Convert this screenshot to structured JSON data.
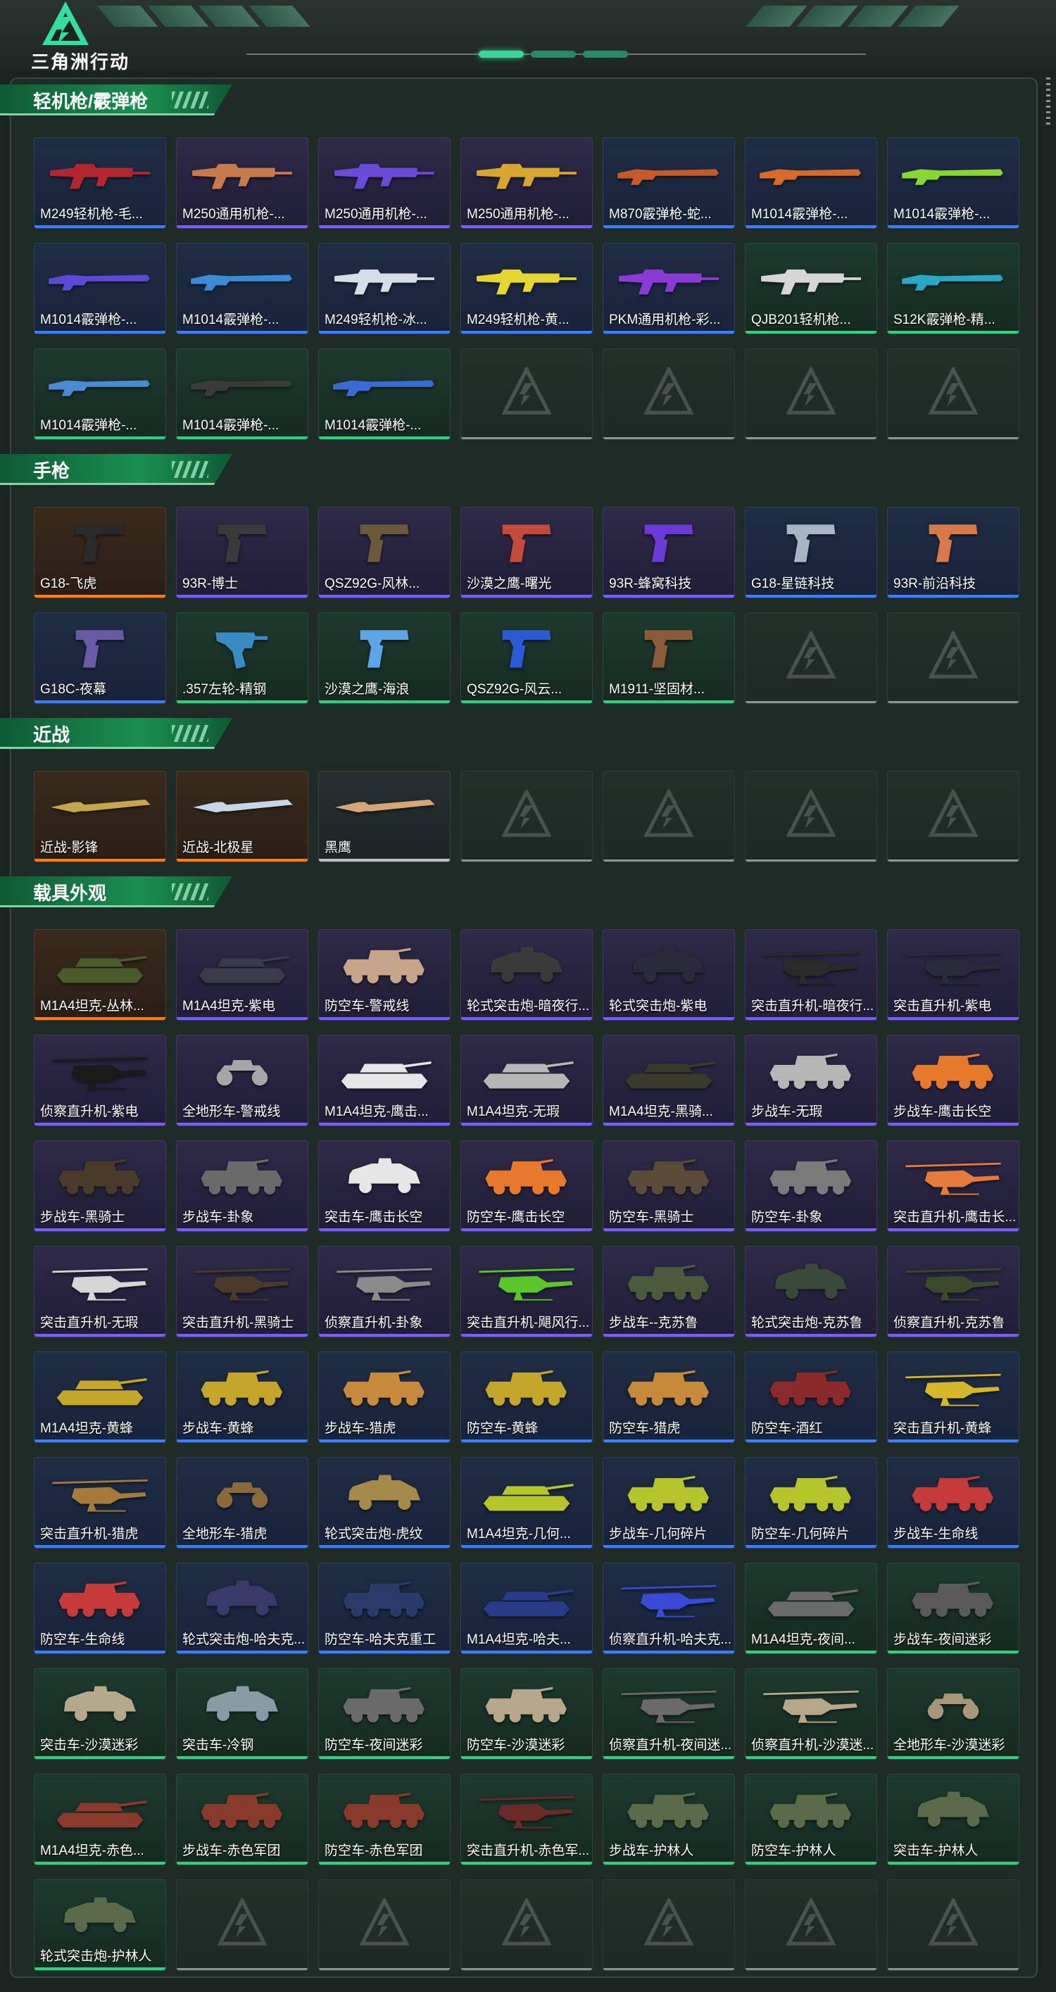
{
  "app": {
    "logo_text": "三角洲行动"
  },
  "sections": [
    {
      "title": "轻机枪/霰弹枪",
      "items": [
        {
          "label": "M249轻机枪-毛...",
          "rarity": "blue",
          "icon": "rifle-icon",
          "color": "#b3262f"
        },
        {
          "label": "M250通用机枪-...",
          "rarity": "purple",
          "icon": "rifle-icon",
          "color": "#c97a4a"
        },
        {
          "label": "M250通用机枪-...",
          "rarity": "purple",
          "icon": "rifle-icon",
          "color": "#6a4ad6"
        },
        {
          "label": "M250通用机枪-...",
          "rarity": "purple",
          "icon": "rifle-icon",
          "color": "#d8a630"
        },
        {
          "label": "M870霰弹枪-蛇...",
          "rarity": "blue",
          "icon": "shotgun-icon",
          "color": "#c75a2a"
        },
        {
          "label": "M1014霰弹枪-...",
          "rarity": "blue",
          "icon": "shotgun-icon",
          "color": "#d86a2a"
        },
        {
          "label": "M1014霰弹枪-...",
          "rarity": "blue",
          "icon": "shotgun-icon",
          "color": "#8ad630"
        },
        {
          "label": "M1014霰弹枪-...",
          "rarity": "blue",
          "icon": "shotgun-icon",
          "color": "#5a4ad6"
        },
        {
          "label": "M1014霰弹枪-...",
          "rarity": "blue",
          "icon": "shotgun-icon",
          "color": "#3a8ad6"
        },
        {
          "label": "M249轻机枪-冰...",
          "rarity": "blue",
          "icon": "rifle-icon",
          "color": "#d6dde6"
        },
        {
          "label": "M249轻机枪-黄...",
          "rarity": "blue",
          "icon": "rifle-icon",
          "color": "#e6d630"
        },
        {
          "label": "PKM通用机枪-彩...",
          "rarity": "blue",
          "icon": "rifle-icon",
          "color": "#8a3ad6"
        },
        {
          "label": "QJB201轻机枪...",
          "rarity": "green",
          "icon": "rifle-icon",
          "color": "#d6d6d6"
        },
        {
          "label": "S12K霰弹枪-精...",
          "rarity": "green",
          "icon": "shotgun-icon",
          "color": "#2aa6c6"
        },
        {
          "label": "M1014霰弹枪-...",
          "rarity": "green",
          "icon": "shotgun-icon",
          "color": "#4a8ad6"
        },
        {
          "label": "M1014霰弹枪-...",
          "rarity": "green",
          "icon": "shotgun-icon",
          "color": "#3a3a3a"
        },
        {
          "label": "M1014霰弹枪-...",
          "rarity": "green",
          "icon": "shotgun-icon",
          "color": "#3a6ad6"
        },
        {
          "label": "",
          "rarity": "empty"
        },
        {
          "label": "",
          "rarity": "empty"
        },
        {
          "label": "",
          "rarity": "empty"
        },
        {
          "label": "",
          "rarity": "empty"
        }
      ]
    },
    {
      "title": "手枪",
      "items": [
        {
          "label": "G18-飞虎",
          "rarity": "orange",
          "icon": "pistol-icon",
          "color": "#2a2a2a"
        },
        {
          "label": "93R-博士",
          "rarity": "purple",
          "icon": "pistol-icon",
          "color": "#3a3a3a"
        },
        {
          "label": "QSZ92G-风林...",
          "rarity": "purple",
          "icon": "pistol-icon",
          "color": "#6a5a3a"
        },
        {
          "label": "沙漠之鹰-曙光",
          "rarity": "purple",
          "icon": "pistol-icon",
          "color": "#c64a3a"
        },
        {
          "label": "93R-蜂窝科技",
          "rarity": "purple",
          "icon": "pistol-icon",
          "color": "#6a3ad6"
        },
        {
          "label": "G18-星链科技",
          "rarity": "blue",
          "icon": "pistol-icon",
          "color": "#a6b6c6"
        },
        {
          "label": "93R-前沿科技",
          "rarity": "blue",
          "icon": "pistol-icon",
          "color": "#d67a4a"
        },
        {
          "label": "G18C-夜幕",
          "rarity": "blue",
          "icon": "pistol-icon",
          "color": "#6a5aa6"
        },
        {
          "label": ".357左轮-精钢",
          "rarity": "green",
          "icon": "revolver-icon",
          "color": "#3a8ac6"
        },
        {
          "label": "沙漠之鹰-海浪",
          "rarity": "green",
          "icon": "pistol-icon",
          "color": "#5aa6e6"
        },
        {
          "label": "QSZ92G-风云...",
          "rarity": "green",
          "icon": "pistol-icon",
          "color": "#2a5ad6"
        },
        {
          "label": "M1911-坚固材...",
          "rarity": "green",
          "icon": "pistol-icon",
          "color": "#8a5a3a"
        },
        {
          "label": "",
          "rarity": "empty"
        },
        {
          "label": "",
          "rarity": "empty"
        }
      ]
    },
    {
      "title": "近战",
      "items": [
        {
          "label": "近战-影锋",
          "rarity": "orange",
          "icon": "knife-icon",
          "color": "#c6a64a"
        },
        {
          "label": "近战-北极星",
          "rarity": "orange",
          "icon": "knife-icon",
          "color": "#c6d6e6"
        },
        {
          "label": "黑鹰",
          "rarity": "gray",
          "icon": "knife-icon",
          "color": "#d6a67a"
        },
        {
          "label": "",
          "rarity": "empty"
        },
        {
          "label": "",
          "rarity": "empty"
        },
        {
          "label": "",
          "rarity": "empty"
        },
        {
          "label": "",
          "rarity": "empty"
        }
      ]
    },
    {
      "title": "载具外观",
      "items": [
        {
          "label": "M1A4坦克-丛林...",
          "rarity": "orange",
          "icon": "tank-icon",
          "color": "#4a5a2a"
        },
        {
          "label": "M1A4坦克-紫电",
          "rarity": "purple",
          "icon": "tank-icon",
          "color": "#3a3a4a"
        },
        {
          "label": "防空车-警戒线",
          "rarity": "purple",
          "icon": "apc-icon",
          "color": "#c6a68a"
        },
        {
          "label": "轮式突击炮-暗夜行...",
          "rarity": "purple",
          "icon": "armored-car-icon",
          "color": "#3a3a3a"
        },
        {
          "label": "轮式突击炮-紫电",
          "rarity": "purple",
          "icon": "armored-car-icon",
          "color": "#2a2a3a"
        },
        {
          "label": "突击直升机-暗夜行...",
          "rarity": "purple",
          "icon": "helicopter-icon",
          "color": "#2a2a2a"
        },
        {
          "label": "突击直升机-紫电",
          "rarity": "purple",
          "icon": "helicopter-icon",
          "color": "#2a2a3a"
        },
        {
          "label": "侦察直升机-紫电",
          "rarity": "purple",
          "icon": "helicopter-icon",
          "color": "#1a1a1a"
        },
        {
          "label": "全地形车-警戒线",
          "rarity": "purple",
          "icon": "atv-icon",
          "color": "#a6a6a6"
        },
        {
          "label": "M1A4坦克-鹰击...",
          "rarity": "purple",
          "icon": "tank-icon",
          "color": "#e6e6e6"
        },
        {
          "label": "M1A4坦克-无瑕",
          "rarity": "purple",
          "icon": "tank-icon",
          "color": "#b6b6b6"
        },
        {
          "label": "M1A4坦克-黑骑...",
          "rarity": "purple",
          "icon": "tank-icon",
          "color": "#3a3a2a"
        },
        {
          "label": "步战车-无瑕",
          "rarity": "purple",
          "icon": "apc-icon",
          "color": "#b6b6b6"
        },
        {
          "label": "步战车-鹰击长空",
          "rarity": "purple",
          "icon": "apc-icon",
          "color": "#e67a2a"
        },
        {
          "label": "步战车-黑骑士",
          "rarity": "purple",
          "icon": "apc-icon",
          "color": "#4a3a2a"
        },
        {
          "label": "步战车-卦象",
          "rarity": "purple",
          "icon": "apc-icon",
          "color": "#6a6a6a"
        },
        {
          "label": "突击车-鹰击长空",
          "rarity": "purple",
          "icon": "armored-car-icon",
          "color": "#e6e6e6"
        },
        {
          "label": "防空车-鹰击长空",
          "rarity": "purple",
          "icon": "apc-icon",
          "color": "#e67a2a"
        },
        {
          "label": "防空车-黑骑士",
          "rarity": "purple",
          "icon": "apc-icon",
          "color": "#5a4a3a"
        },
        {
          "label": "防空车-卦象",
          "rarity": "purple",
          "icon": "apc-icon",
          "color": "#7a7a7a"
        },
        {
          "label": "突击直升机-鹰击长...",
          "rarity": "purple",
          "icon": "helicopter-icon",
          "color": "#e67a3a"
        },
        {
          "label": "突击直升机-无瑕",
          "rarity": "purple",
          "icon": "helicopter-icon",
          "color": "#d6d6d6"
        },
        {
          "label": "突击直升机-黑骑士",
          "rarity": "purple",
          "icon": "helicopter-icon",
          "color": "#4a3a2a"
        },
        {
          "label": "侦察直升机-卦象",
          "rarity": "purple",
          "icon": "helicopter-icon",
          "color": "#8a8a8a"
        },
        {
          "label": "突击直升机-飓风行...",
          "rarity": "purple",
          "icon": "helicopter-icon",
          "color": "#5ac62a"
        },
        {
          "label": "步战车--克苏鲁",
          "rarity": "purple",
          "icon": "apc-icon",
          "color": "#4a5a3a"
        },
        {
          "label": "轮式突击炮-克苏鲁",
          "rarity": "purple",
          "icon": "armored-car-icon",
          "color": "#3a4a3a"
        },
        {
          "label": "侦察直升机-克苏鲁",
          "rarity": "purple",
          "icon": "helicopter-icon",
          "color": "#3a4a2a"
        },
        {
          "label": "M1A4坦克-黄蜂",
          "rarity": "blue",
          "icon": "tank-icon",
          "color": "#c6a62a"
        },
        {
          "label": "步战车-黄蜂",
          "rarity": "blue",
          "icon": "apc-icon",
          "color": "#c6a62a"
        },
        {
          "label": "步战车-猎虎",
          "rarity": "blue",
          "icon": "apc-icon",
          "color": "#c68a3a"
        },
        {
          "label": "防空车-黄蜂",
          "rarity": "blue",
          "icon": "apc-icon",
          "color": "#c6a62a"
        },
        {
          "label": "防空车-猎虎",
          "rarity": "blue",
          "icon": "apc-icon",
          "color": "#c68a3a"
        },
        {
          "label": "防空车-酒红",
          "rarity": "blue",
          "icon": "apc-icon",
          "color": "#8a2a2a"
        },
        {
          "label": "突击直升机-黄蜂",
          "rarity": "blue",
          "icon": "helicopter-icon",
          "color": "#d6b62a"
        },
        {
          "label": "突击直升机-猎虎",
          "rarity": "blue",
          "icon": "helicopter-icon",
          "color": "#a67a3a"
        },
        {
          "label": "全地形车-猎虎",
          "rarity": "blue",
          "icon": "atv-icon",
          "color": "#8a6a3a"
        },
        {
          "label": "轮式突击炮-虎纹",
          "rarity": "blue",
          "icon": "armored-car-icon",
          "color": "#a68a4a"
        },
        {
          "label": "M1A4坦克-几何...",
          "rarity": "blue",
          "icon": "tank-icon",
          "color": "#b6c62a"
        },
        {
          "label": "步战车-几何碎片",
          "rarity": "blue",
          "icon": "apc-icon",
          "color": "#b6c62a"
        },
        {
          "label": "防空车-几何碎片",
          "rarity": "blue",
          "icon": "apc-icon",
          "color": "#b6c62a"
        },
        {
          "label": "步战车-生命线",
          "rarity": "blue",
          "icon": "apc-icon",
          "color": "#c63a3a"
        },
        {
          "label": "防空车-生命线",
          "rarity": "blue",
          "icon": "apc-icon",
          "color": "#c63a3a"
        },
        {
          "label": "轮式突击炮-哈夫克...",
          "rarity": "blue",
          "icon": "armored-car-icon",
          "color": "#3a3a6a"
        },
        {
          "label": "防空车-哈夫克重工",
          "rarity": "blue",
          "icon": "apc-icon",
          "color": "#2a3a6a"
        },
        {
          "label": "M1A4坦克-哈夫...",
          "rarity": "blue",
          "icon": "tank-icon",
          "color": "#2a3a8a"
        },
        {
          "label": "侦察直升机-哈夫克...",
          "rarity": "blue",
          "icon": "helicopter-icon",
          "color": "#3a4ad6"
        },
        {
          "label": "M1A4坦克-夜间...",
          "rarity": "green",
          "icon": "tank-icon",
          "color": "#6a6a6a"
        },
        {
          "label": "步战车-夜间迷彩",
          "rarity": "green",
          "icon": "apc-icon",
          "color": "#5a5a5a"
        },
        {
          "label": "突击车-沙漠迷彩",
          "rarity": "green",
          "icon": "armored-car-icon",
          "color": "#b6a68a"
        },
        {
          "label": "突击车-冷钢",
          "rarity": "green",
          "icon": "armored-car-icon",
          "color": "#8a9aa6"
        },
        {
          "label": "防空车-夜间迷彩",
          "rarity": "green",
          "icon": "apc-icon",
          "color": "#6a6a6a"
        },
        {
          "label": "防空车-沙漠迷彩",
          "rarity": "green",
          "icon": "apc-icon",
          "color": "#b6a68a"
        },
        {
          "label": "侦察直升机-夜间迷...",
          "rarity": "green",
          "icon": "helicopter-icon",
          "color": "#6a6a6a"
        },
        {
          "label": "侦察直升机-沙漠迷...",
          "rarity": "green",
          "icon": "helicopter-icon",
          "color": "#b6a68a"
        },
        {
          "label": "全地形车-沙漠迷彩",
          "rarity": "green",
          "icon": "atv-icon",
          "color": "#a6967a"
        },
        {
          "label": "M1A4坦克-赤色...",
          "rarity": "green",
          "icon": "tank-icon",
          "color": "#8a3a2a"
        },
        {
          "label": "步战车-赤色军团",
          "rarity": "green",
          "icon": "apc-icon",
          "color": "#8a3a2a"
        },
        {
          "label": "防空车-赤色军团",
          "rarity": "green",
          "icon": "apc-icon",
          "color": "#8a3a2a"
        },
        {
          "label": "突击直升机-赤色军...",
          "rarity": "green",
          "icon": "helicopter-icon",
          "color": "#6a2a2a"
        },
        {
          "label": "步战车-护林人",
          "rarity": "green",
          "icon": "apc-icon",
          "color": "#5a6a4a"
        },
        {
          "label": "防空车-护林人",
          "rarity": "green",
          "icon": "apc-icon",
          "color": "#5a6a4a"
        },
        {
          "label": "突击车-护林人",
          "rarity": "green",
          "icon": "armored-car-icon",
          "color": "#5a6a4a"
        },
        {
          "label": "轮式突击炮-护林人",
          "rarity": "green",
          "icon": "armored-car-icon",
          "color": "#5a6a4a"
        },
        {
          "label": "",
          "rarity": "empty"
        },
        {
          "label": "",
          "rarity": "empty"
        },
        {
          "label": "",
          "rarity": "empty"
        },
        {
          "label": "",
          "rarity": "empty"
        },
        {
          "label": "",
          "rarity": "empty"
        },
        {
          "label": "",
          "rarity": "empty"
        }
      ]
    }
  ]
}
